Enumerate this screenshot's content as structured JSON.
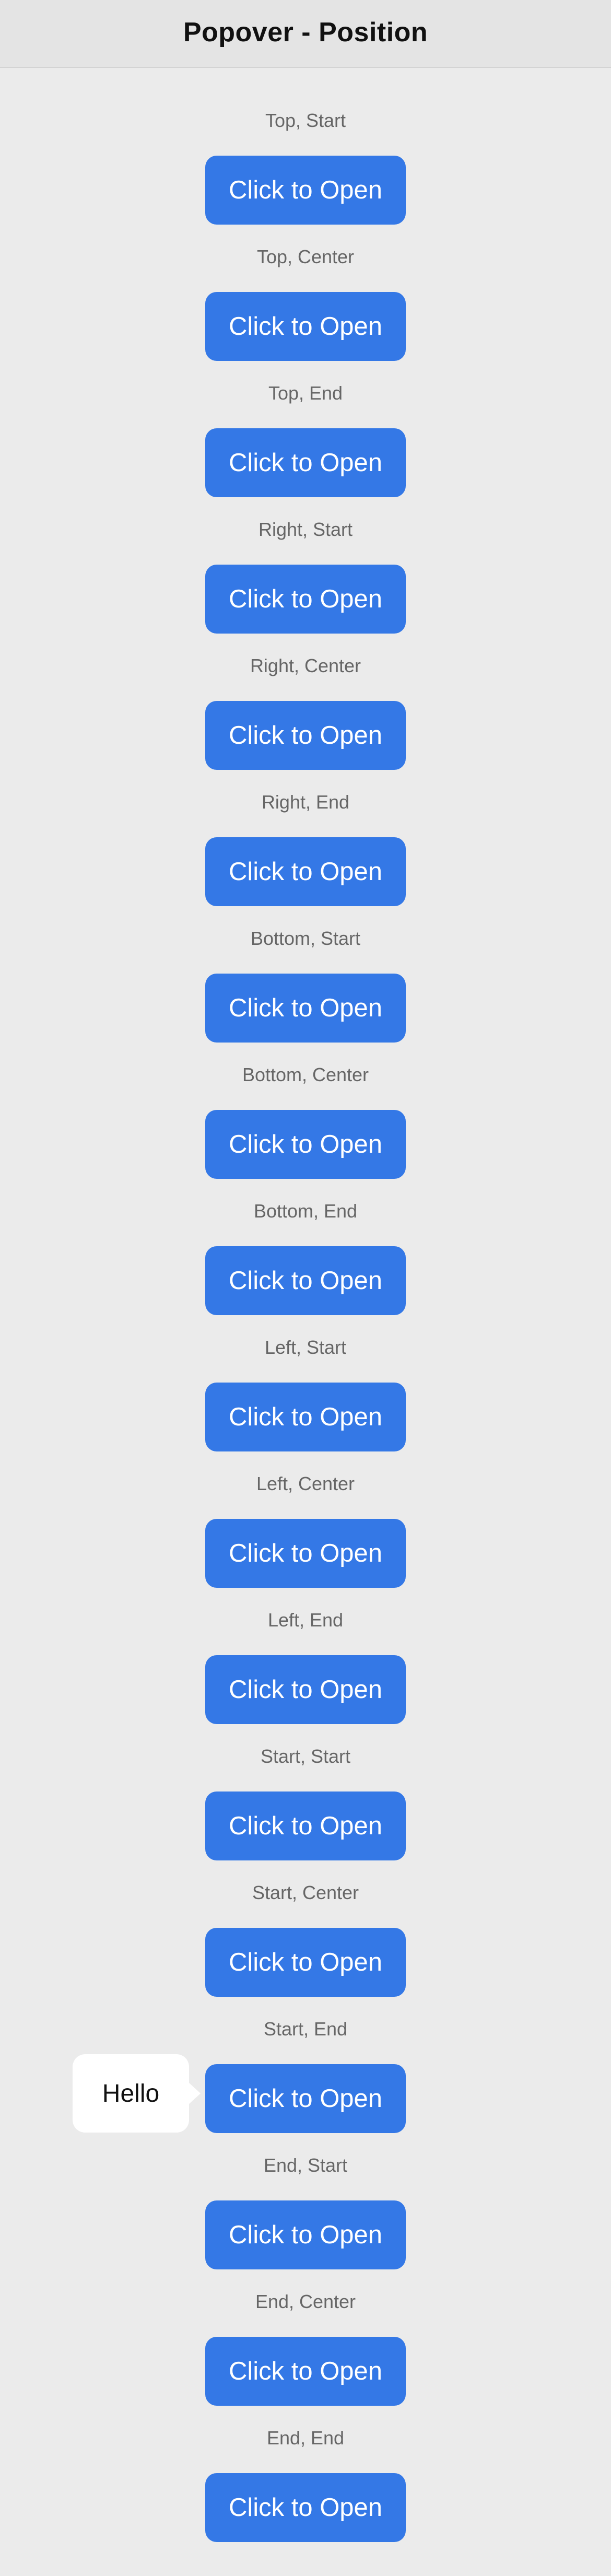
{
  "header": {
    "title": "Popover - Position"
  },
  "sections": [
    {
      "label": "Top, Start",
      "button": "Click to Open"
    },
    {
      "label": "Top, Center",
      "button": "Click to Open"
    },
    {
      "label": "Top, End",
      "button": "Click to Open"
    },
    {
      "label": "Right, Start",
      "button": "Click to Open"
    },
    {
      "label": "Right, Center",
      "button": "Click to Open"
    },
    {
      "label": "Right, End",
      "button": "Click to Open"
    },
    {
      "label": "Bottom, Start",
      "button": "Click to Open"
    },
    {
      "label": "Bottom, Center",
      "button": "Click to Open"
    },
    {
      "label": "Bottom, End",
      "button": "Click to Open"
    },
    {
      "label": "Left, Start",
      "button": "Click to Open"
    },
    {
      "label": "Left, Center",
      "button": "Click to Open"
    },
    {
      "label": "Left, End",
      "button": "Click to Open"
    },
    {
      "label": "Start, Start",
      "button": "Click to Open"
    },
    {
      "label": "Start, Center",
      "button": "Click to Open"
    },
    {
      "label": "Start, End",
      "button": "Click to Open"
    },
    {
      "label": "End, Start",
      "button": "Click to Open"
    },
    {
      "label": "End, Center",
      "button": "Click to Open"
    },
    {
      "label": "End, End",
      "button": "Click to Open"
    }
  ],
  "popover": {
    "text": "Hello"
  },
  "colors": {
    "accent": "#3478e6",
    "background": "#ebebeb",
    "header_background": "#e4e4e4"
  }
}
